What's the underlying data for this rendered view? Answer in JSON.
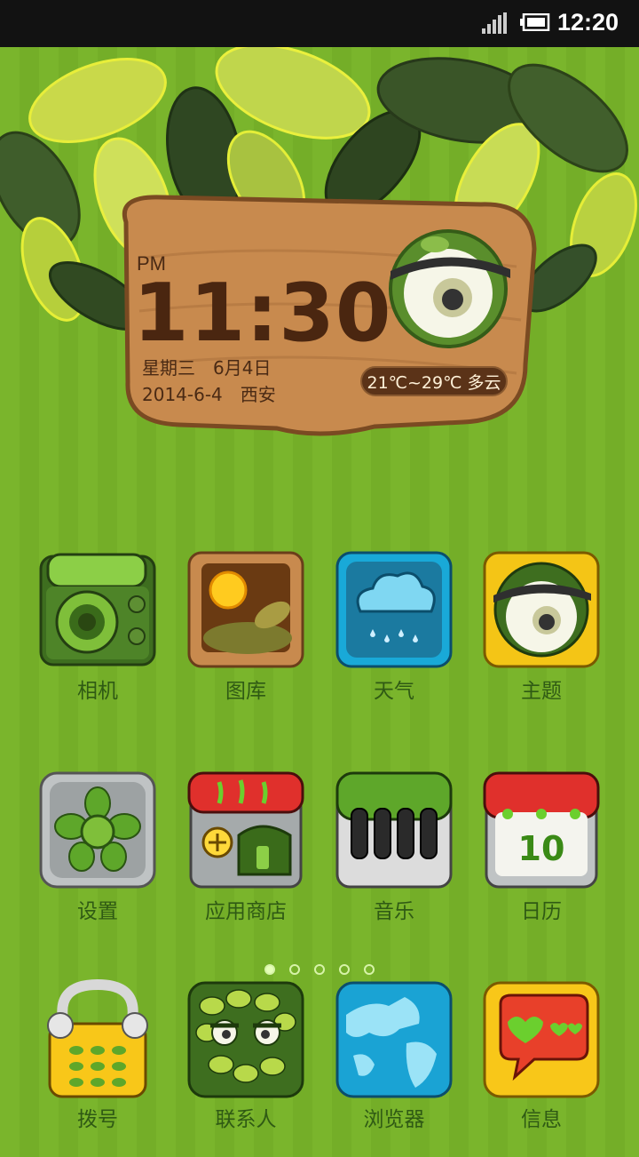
{
  "status_bar": {
    "time": "12:20"
  },
  "clock_widget": {
    "ampm": "PM",
    "time": "11:30",
    "weekday_date": "星期三　6月4日",
    "date_city": "2014-6-4　西安",
    "weather": "21℃~29℃ 多云"
  },
  "apps": [
    {
      "label": "相机",
      "icon": "camera-icon"
    },
    {
      "label": "图库",
      "icon": "gallery-icon"
    },
    {
      "label": "天气",
      "icon": "weather-icon"
    },
    {
      "label": "主题",
      "icon": "theme-icon"
    },
    {
      "label": "设置",
      "icon": "settings-icon"
    },
    {
      "label": "应用商店",
      "icon": "app-store-icon"
    },
    {
      "label": "音乐",
      "icon": "music-icon"
    },
    {
      "label": "日历",
      "icon": "calendar-icon",
      "badge": "10"
    },
    {
      "label": "拨号",
      "icon": "phone-icon"
    },
    {
      "label": "联系人",
      "icon": "contacts-icon"
    },
    {
      "label": "浏览器",
      "icon": "browser-icon"
    },
    {
      "label": "信息",
      "icon": "messages-icon"
    }
  ],
  "page_indicator": {
    "pages": 5,
    "active": 1
  },
  "colors": {
    "background": "#7ab52c",
    "wood": "#c88a4e",
    "label": "#2f5a14"
  }
}
